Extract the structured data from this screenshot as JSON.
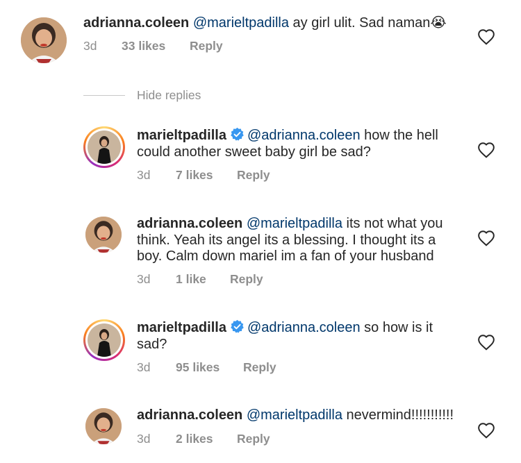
{
  "comments": [
    {
      "username": "adrianna.coleen",
      "mention": "@marieltpadilla",
      "text": " ay girl ulit. Sad naman😭",
      "age": "3d",
      "likes": "33 likes",
      "reply": "Reply"
    },
    {
      "username": "marieltpadilla",
      "mention": "@adrianna.coleen",
      "text_line1": " how the hell",
      "text_line2": "could another sweet baby girl be sad?",
      "age": "3d",
      "likes": "7 likes",
      "reply": "Reply"
    },
    {
      "username": "adrianna.coleen",
      "mention": "@marieltpadilla",
      "text_line1": " its not what you",
      "text_line2": "think. Yeah its angel its a blessing. I thought its a",
      "text_line3": "boy. Calm down mariel im a fan of your husband",
      "age": "3d",
      "likes": "1 like",
      "reply": "Reply"
    },
    {
      "username": "marieltpadilla",
      "mention": "@adrianna.coleen",
      "text_line1": " so how is it",
      "text_line2": "sad?",
      "age": "3d",
      "likes": "95 likes",
      "reply": "Reply"
    },
    {
      "username": "adrianna.coleen",
      "mention": "@marieltpadilla",
      "text": " nevermind!!!!!!!!!!!",
      "age": "3d",
      "likes": "2 likes",
      "reply": "Reply"
    }
  ],
  "hide_replies_label": "Hide replies",
  "colors": {
    "text": "#262626",
    "mention": "#00376b",
    "meta": "#8e8e8e",
    "verified": "#3897f0"
  },
  "icons": {
    "like": "heart-outline-icon",
    "verified": "verified-badge-icon"
  }
}
